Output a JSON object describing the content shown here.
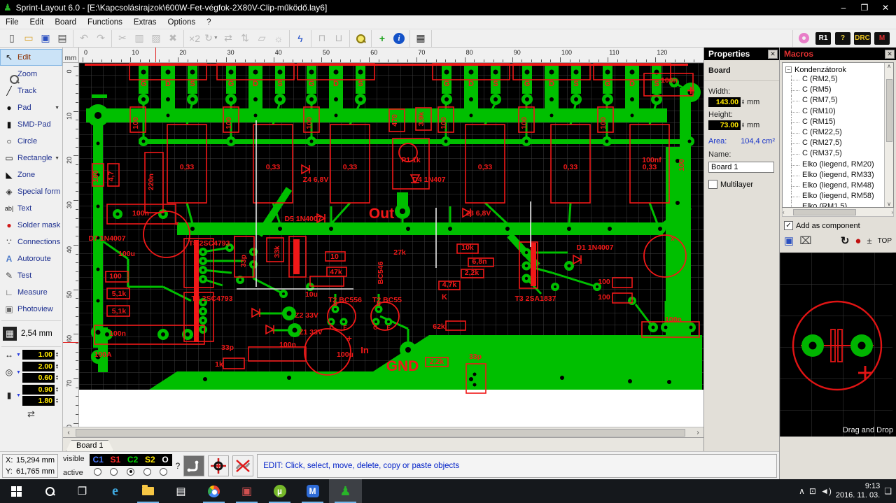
{
  "window": {
    "title": "Sprint-Layout 6.0 - [E:\\Kapcsolásirajzok\\600W-Fet-végfok-2X80V-Clip-működő.lay6]"
  },
  "menu": {
    "items": [
      "File",
      "Edit",
      "Board",
      "Functions",
      "Extras",
      "Options",
      "?"
    ]
  },
  "toolbar": {
    "groups": [
      {
        "items": [
          {
            "n": "new-file",
            "g": "▯",
            "c": "#555"
          },
          {
            "n": "open-folder",
            "g": "▭",
            "c": "#d9a430"
          },
          {
            "n": "save",
            "g": "▣",
            "c": "#2a4fc0"
          },
          {
            "n": "print",
            "g": "▤",
            "c": "#555"
          }
        ]
      },
      {
        "items": [
          {
            "n": "undo",
            "g": "↶",
            "dim": 1
          },
          {
            "n": "redo",
            "g": "↷",
            "dim": 1
          }
        ]
      },
      {
        "items": [
          {
            "n": "cut",
            "g": "✂",
            "dim": 1
          },
          {
            "n": "copy",
            "g": "▥",
            "dim": 1
          },
          {
            "n": "paste",
            "g": "▨",
            "dim": 1
          },
          {
            "n": "delete",
            "g": "✖",
            "dim": 1
          }
        ]
      },
      {
        "items": [
          {
            "n": "duplicate",
            "g": "×2",
            "dim": 1
          },
          {
            "n": "rotate",
            "g": "↻",
            "dim": 1,
            "caret": 1
          },
          {
            "n": "mirror-horizontal",
            "g": "⇄",
            "dim": 1
          },
          {
            "n": "mirror-vertical",
            "g": "⇅",
            "dim": 1
          },
          {
            "n": "flip-board",
            "g": "▱",
            "dim": 1
          },
          {
            "n": "align",
            "g": "☼",
            "dim": 1
          }
        ]
      },
      {
        "items": [
          {
            "n": "rubberband-route",
            "g": "ϟ",
            "c": "#1848c8"
          }
        ]
      },
      {
        "items": [
          {
            "n": "lock",
            "g": "⊓",
            "dim": 1
          },
          {
            "n": "unlock",
            "g": "⊔",
            "dim": 1
          }
        ]
      },
      {
        "items": [
          {
            "n": "zoom-tool",
            "special": "mag",
            "mc": "#8a7a10",
            "mf": "#f5e868"
          }
        ]
      },
      {
        "items": [
          {
            "n": "snap-crosshair",
            "g": "+",
            "c": "#18a018",
            "bold": 1
          },
          {
            "n": "info",
            "special": "info"
          }
        ]
      },
      {
        "items": [
          {
            "n": "grid-settings",
            "g": "▦",
            "c": "#333"
          }
        ]
      }
    ],
    "right_groups": [
      {
        "items": [
          {
            "n": "photoview-mask",
            "special": "donut"
          },
          {
            "n": "r1-component",
            "badge": "R1",
            "bg": "#111",
            "fg": "#fff"
          },
          {
            "n": "help-component",
            "badge": "?",
            "bg": "#111",
            "fg": "#e8d040"
          },
          {
            "n": "drc-check",
            "badge": "DRC",
            "bg": "#111",
            "fg": "#e8c020"
          },
          {
            "n": "metal-layer",
            "badge": "M",
            "bg": "#111",
            "fg": "#e03030"
          }
        ]
      }
    ]
  },
  "sidebar": {
    "tools": [
      {
        "n": "tool-edit",
        "label": "Edit",
        "g": "↖",
        "c": "#222",
        "sel": 1
      },
      {
        "n": "tool-zoom",
        "label": "Zoom",
        "special": "mag",
        "mc": "#555"
      },
      {
        "n": "tool-track",
        "label": "Track",
        "g": "╱",
        "c": "#111"
      },
      {
        "n": "tool-pad",
        "label": "Pad",
        "g": "●",
        "c": "#111",
        "caret": 1
      },
      {
        "n": "tool-smd-pad",
        "label": "SMD-Pad",
        "g": "▮",
        "c": "#111"
      },
      {
        "n": "tool-circle",
        "label": "Circle",
        "g": "○",
        "c": "#111",
        "bold": 1
      },
      {
        "n": "tool-rectangle",
        "label": "Rectangle",
        "g": "▭",
        "c": "#111",
        "caret": 1
      },
      {
        "n": "tool-zone",
        "label": "Zone",
        "g": "◣",
        "c": "#111"
      },
      {
        "n": "tool-special-form",
        "label": "Special form",
        "g": "◈",
        "c": "#333"
      },
      {
        "n": "tool-text",
        "label": "Text",
        "g": "ab|",
        "c": "#111",
        "small": 1
      },
      {
        "n": "tool-solder-mask",
        "label": "Solder mask",
        "g": "●",
        "c": "#d01818"
      },
      {
        "n": "tool-connections",
        "label": "Connections",
        "g": "∵",
        "c": "#333"
      },
      {
        "n": "tool-autoroute",
        "label": "Autoroute",
        "g": "A",
        "c": "#4a78c8",
        "bold": 1
      },
      {
        "n": "tool-test",
        "label": "Test",
        "g": "✎",
        "c": "#444"
      },
      {
        "n": "tool-measure",
        "label": "Measure",
        "g": "∟",
        "c": "#444"
      },
      {
        "n": "tool-photoview",
        "label": "Photoview",
        "g": "▣",
        "c": "#666"
      }
    ],
    "grid_label": "2,54 mm",
    "track_width": "1.00",
    "pad_outer": "2.00",
    "pad_drill": "0.60",
    "smd_width": "0.90",
    "smd_height": "1.80"
  },
  "rulers": {
    "unit": "mm",
    "h_max": 130,
    "v_max": 80,
    "cursor_mm_x": 15.3,
    "cursor_mm_y": 61.8
  },
  "properties": {
    "title": "Properties",
    "section": "Board",
    "width_label": "Width:",
    "width_value": "143.00",
    "width_unit": "mm",
    "height_label": "Height:",
    "height_value": "73.00",
    "height_unit": "mm",
    "area_label": "Area:",
    "area_value": "104,4 cm²",
    "name_label": "Name:",
    "name_value": "Board 1",
    "multilayer_label": "Multilayer"
  },
  "macros": {
    "title": "Macros",
    "root": "Kondenzátorok",
    "items": [
      "C (RM2,5)",
      "C (RM5)",
      "C (RM7,5)",
      "C (RM10)",
      "C (RM15)",
      "C (RM22,5)",
      "C (RM27,5)",
      "C (RM37,5)",
      "Elko (liegend, RM20)",
      "Elko (liegend, RM33)",
      "Elko (liegend, RM48)",
      "Elko (liegend, RM58)",
      "Elko (RM1,5)"
    ],
    "add_as_component": "Add as component",
    "top_label": "TOP",
    "drag_drop": "Drag and Drop"
  },
  "statusbar": {
    "x_label": "X:",
    "x_value": "15,294 mm",
    "y_label": "Y:",
    "y_value": "61,765 mm",
    "visible_label": "visible",
    "active_label": "active",
    "layers": [
      {
        "name": "C1",
        "color": "#4878ff"
      },
      {
        "name": "S1",
        "color": "#ff2a2a"
      },
      {
        "name": "C2",
        "color": "#00dc00",
        "active": true
      },
      {
        "name": "S2",
        "color": "#ffe800"
      },
      {
        "name": "O",
        "color": "#ffffff"
      }
    ],
    "help_mark": "?",
    "hint": "EDIT:  Click, select, move, delete, copy or paste objects",
    "tab": "Board 1"
  },
  "taskbar": {
    "icons": [
      "start",
      "search",
      "task-view",
      "edge",
      "file-explorer",
      "store",
      "chrome",
      "layout-file",
      "utorrent",
      "malwarebytes",
      "sprint-layout"
    ],
    "time": "9:13",
    "date": "2016. 11. 03."
  },
  "pcb": {
    "gds": [
      "G",
      "D",
      "S"
    ],
    "colors": {
      "trace": "#00bf00",
      "silk": "#f01818",
      "grid": "#3f3f3f",
      "board": "#000000"
    },
    "labels": [
      [
        "100n",
        843,
        28
      ],
      [
        "0,33",
        154,
        152
      ],
      [
        "0,33",
        277,
        152
      ],
      [
        "0,33",
        387,
        152
      ],
      [
        "0,33",
        580,
        152
      ],
      [
        "0,33",
        702,
        152
      ],
      [
        "0,33",
        815,
        152
      ],
      [
        "100",
        84,
        86,
        -90
      ],
      [
        "100",
        217,
        86,
        -90
      ],
      [
        "100",
        332,
        86,
        -90
      ],
      [
        "100",
        524,
        86,
        -90
      ],
      [
        "100",
        639,
        86,
        -90
      ],
      [
        "100",
        752,
        86,
        -90
      ],
      [
        "470",
        454,
        82,
        -90
      ],
      [
        "3,9k",
        492,
        80,
        -90
      ],
      [
        "220n",
        106,
        170,
        -90
      ],
      [
        "4,7",
        49,
        162,
        -90
      ],
      [
        "100",
        27,
        162,
        -90
      ],
      [
        "Z4 6,8V",
        338,
        170
      ],
      [
        "D5 1N4007",
        320,
        226
      ],
      [
        "P1 1k",
        474,
        142
      ],
      [
        "D4 1N407",
        500,
        170
      ],
      [
        "Z3 6,8V",
        570,
        218
      ],
      [
        "Out",
        432,
        222,
        0,
        21
      ],
      [
        "100nf",
        818,
        142
      ],
      [
        "100",
        864,
        146,
        -90
      ],
      [
        "100n",
        88,
        218
      ],
      [
        "D7 1N4007",
        40,
        254
      ],
      [
        "100u",
        68,
        276
      ],
      [
        "100",
        52,
        308
      ],
      [
        "5,1k",
        57,
        333
      ],
      [
        "5,1k",
        57,
        358
      ],
      [
        "100n",
        55,
        390
      ],
      [
        "100A",
        34,
        420
      ],
      [
        "T5 2SC4793",
        186,
        261
      ],
      [
        "T4 2SC4793",
        190,
        340
      ],
      [
        "33p",
        238,
        283,
        -90
      ],
      [
        "33k",
        286,
        270,
        -90
      ],
      [
        "10",
        365,
        280
      ],
      [
        "47k",
        367,
        302
      ],
      [
        "10u",
        332,
        334
      ],
      [
        "T2 BC556",
        380,
        342
      ],
      [
        "T2 BC55",
        440,
        342
      ],
      [
        "BC546",
        434,
        300,
        -90
      ],
      [
        "Z2 33V",
        325,
        364
      ],
      [
        "Z1 33V",
        331,
        388
      ],
      [
        "100n",
        298,
        406
      ],
      [
        "100u",
        380,
        420
      ],
      [
        "In",
        408,
        415,
        0,
        13
      ],
      [
        "GND",
        462,
        440,
        0,
        21
      ],
      [
        "1k",
        200,
        434
      ],
      [
        "33p",
        212,
        410
      ],
      [
        "62k",
        514,
        380
      ],
      [
        "2,2k",
        511,
        430
      ],
      [
        "33p",
        566,
        423
      ],
      [
        "10k",
        555,
        267
      ],
      [
        "27k",
        458,
        274
      ],
      [
        "6,8n",
        572,
        287
      ],
      [
        "2,2k",
        561,
        303
      ],
      [
        "4,7k",
        529,
        320
      ],
      [
        "T3 2SA1837",
        652,
        340
      ],
      [
        "D1 1N4007",
        737,
        267
      ],
      [
        "100",
        750,
        316
      ],
      [
        "100",
        750,
        338
      ],
      [
        "100n",
        849,
        370
      ],
      [
        "B",
        366,
        347,
        0,
        8
      ],
      [
        "C",
        361,
        381,
        0,
        8
      ],
      [
        "E",
        380,
        381,
        0,
        8
      ],
      [
        "B",
        428,
        347,
        0,
        8
      ],
      [
        "C",
        423,
        381,
        0,
        8
      ],
      [
        "E",
        442,
        381,
        0,
        8
      ],
      [
        "K",
        522,
        338,
        0,
        11
      ],
      [
        "x",
        140,
        232,
        0,
        9
      ],
      [
        "x",
        848,
        254,
        0,
        9
      ],
      [
        "+",
        874,
        46,
        0,
        20
      ],
      [
        "+",
        386,
        398,
        0,
        13
      ]
    ]
  },
  "preview": {
    "component": "capacitor-footprint"
  }
}
